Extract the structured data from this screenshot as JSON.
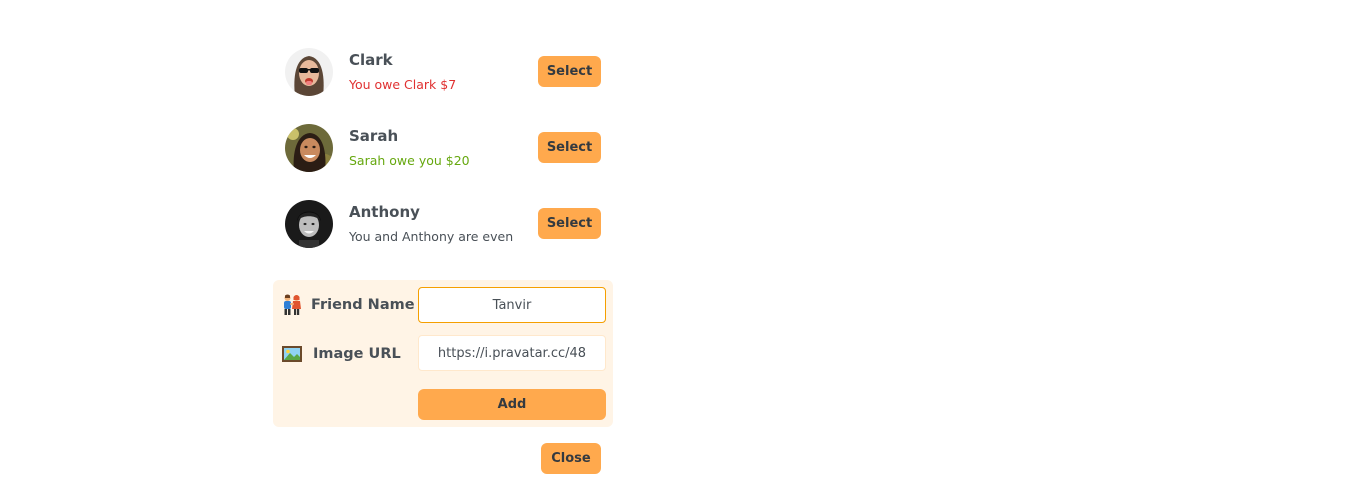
{
  "friends": [
    {
      "name": "Clark",
      "status": "You owe Clark $7",
      "status_type": "owe",
      "avatar": "clark-avatar"
    },
    {
      "name": "Sarah",
      "status": "Sarah owe you $20",
      "status_type": "owed",
      "avatar": "sarah-avatar"
    },
    {
      "name": "Anthony",
      "status": "You and Anthony are even",
      "status_type": "even",
      "avatar": "anthony-avatar"
    }
  ],
  "select_label": "Select",
  "form": {
    "friend_name_icon": "two-people-icon",
    "friend_name_label": "Friend Name",
    "friend_name_value": "Tanvir",
    "image_url_icon": "framed-picture-icon",
    "image_url_label": "Image URL",
    "image_url_value": "https://i.pravatar.cc/48",
    "add_label": "Add"
  },
  "close_label": "Close",
  "colors": {
    "accent": "#ffa94d",
    "form_bg": "#fff4e6",
    "owe": "#e03131",
    "owed": "#66a80f"
  }
}
